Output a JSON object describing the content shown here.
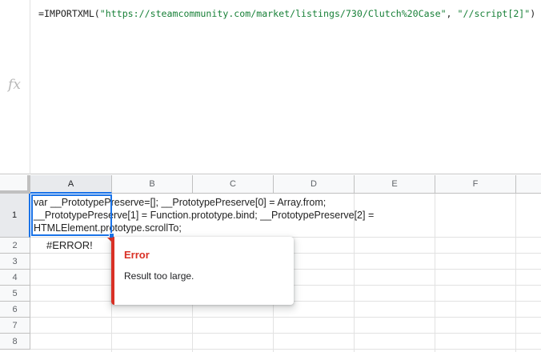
{
  "formula_bar": {
    "fx_label": "fx",
    "formula_prefix": "=IMPORTXML(",
    "formula_arg1": "\"https://steamcommunity.com/market/listings/730/Clutch%20Case\"",
    "formula_sep": ", ",
    "formula_arg2": "\"//script[2]\"",
    "formula_suffix": ")"
  },
  "columns": [
    "A",
    "B",
    "C",
    "D",
    "E",
    "F"
  ],
  "rows": [
    "1",
    "2",
    "3",
    "4",
    "5",
    "6",
    "7",
    "8"
  ],
  "cells": {
    "a1_lines": [
      " var __PrototypePreserve=[]; __PrototypePreserve[0] = Array.from;",
      "__PrototypePreserve[1] = Function.prototype.bind; __PrototypePreserve[2] =",
      "HTMLElement.prototype.scrollTo;"
    ],
    "a2": "#ERROR!"
  },
  "error_popup": {
    "title": "Error",
    "message": "Result too large."
  },
  "colors": {
    "selection": "#1a73e8",
    "error": "#d93025",
    "string_literal": "#188038"
  }
}
